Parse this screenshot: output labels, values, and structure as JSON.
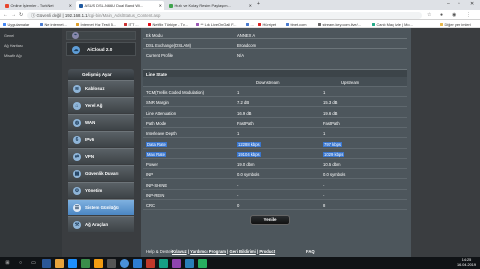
{
  "browser": {
    "tabs": [
      {
        "label": "Online İşlemler - TurkNet",
        "active": false
      },
      {
        "label": "ASUS DSL-N66U Dual Band Wi...",
        "active": true
      },
      {
        "label": "Hızlı ve Kolay Resim Paylaşım...",
        "active": false
      }
    ],
    "new_tab": "+",
    "address": {
      "security": "Güvenli değil",
      "host": "192.168.1.1",
      "path": "/cgi-bin/Main_AdslStatus_Content.asp"
    },
    "bookmarks": [
      "Uygulamalar",
      "Ne internet...",
      "İnternet Hız Testi 5...",
      "ITT ...",
      "Netflix Türkiye - Tv...",
      "** Lık LiveOnGall F...",
      "...",
      "Hürriyet",
      "ttnet.com",
      "stream.key.com.live/...",
      "Canlı Maç izle | Mo...",
      "Diğer yer imleri"
    ]
  },
  "left_nav": [
    "Genel",
    "Ağ Haritası",
    "Misafir Ağı"
  ],
  "sidebar": {
    "aicloud": "AiCloud 2.0",
    "section_title": "Gelişmiş Ayar",
    "items": [
      {
        "label": "Kablosuz",
        "icon": "wifi-icon",
        "active": false
      },
      {
        "label": "Yerel Ağ",
        "icon": "home-icon",
        "active": false
      },
      {
        "label": "WAN",
        "icon": "globe-icon",
        "active": false
      },
      {
        "label": "IPv6",
        "icon": "ipv6-icon",
        "active": false
      },
      {
        "label": "VPN",
        "icon": "vpn-icon",
        "active": false
      },
      {
        "label": "Güvenlik Duvarı",
        "icon": "firewall-icon",
        "active": false
      },
      {
        "label": "Yönetim",
        "icon": "admin-icon",
        "active": false
      },
      {
        "label": "Sistem Günlüğü",
        "icon": "log-icon",
        "active": true
      },
      {
        "label": "Ağ Araçları",
        "icon": "tools-icon",
        "active": false
      }
    ]
  },
  "info": {
    "rows": [
      {
        "key": "Ek Modu",
        "value": "ANNEX A"
      },
      {
        "key": "DSL Exchange(DSLAM)",
        "value": "Broadcom"
      },
      {
        "key": "Current Profile",
        "value": "N/A"
      }
    ]
  },
  "line_state": {
    "title": "Line State",
    "columns": [
      "",
      "Downstream",
      "Upstream"
    ],
    "rows": [
      {
        "label": "TCM(Trellis Coded Modulation)",
        "down": "1",
        "up": "1",
        "highlight": false
      },
      {
        "label": "SNR Margin",
        "down": "7.2 dB",
        "up": "15.3 dB",
        "highlight": false
      },
      {
        "label": "Line Attenuation",
        "down": "16.9 dB",
        "up": "19.6 dB",
        "highlight": false
      },
      {
        "label": "Path Mode",
        "down": "FastPath",
        "up": "FastPath",
        "highlight": false
      },
      {
        "label": "Interleave Depth",
        "down": "1",
        "up": "1",
        "highlight": false
      },
      {
        "label": "Data Rate",
        "down": "12288 kbps",
        "up": "797 kbps",
        "highlight": true
      },
      {
        "label": "Max Rate",
        "down": "19104 kbps",
        "up": "1029 kbps",
        "highlight": true
      },
      {
        "label": "Power",
        "down": "19.0 dbm",
        "up": "10.5 dbm",
        "highlight": false
      },
      {
        "label": "INP",
        "down": "0.0 symbols",
        "up": "0.0 symbols",
        "highlight": false
      },
      {
        "label": "INP-SHINE",
        "down": "-",
        "up": "-",
        "highlight": false
      },
      {
        "label": "INP-REIN",
        "down": "-",
        "up": "-",
        "highlight": false
      },
      {
        "label": "CRC",
        "down": "0",
        "up": "8",
        "highlight": false
      }
    ]
  },
  "apply_label": "Yenile",
  "footer": {
    "help": "Help & Destek",
    "links": [
      "Kılavuz",
      "Yardımcı Program",
      "Geri Bildirimi",
      "Product"
    ],
    "sep": " | ",
    "faq": "FAQ"
  },
  "taskbar": {
    "time": "14:25",
    "date": "16.04.2019"
  },
  "colors": {
    "highlight": "#3a77d0",
    "active_nav": "#4b86c2",
    "panel_bg": "#4d565c"
  }
}
